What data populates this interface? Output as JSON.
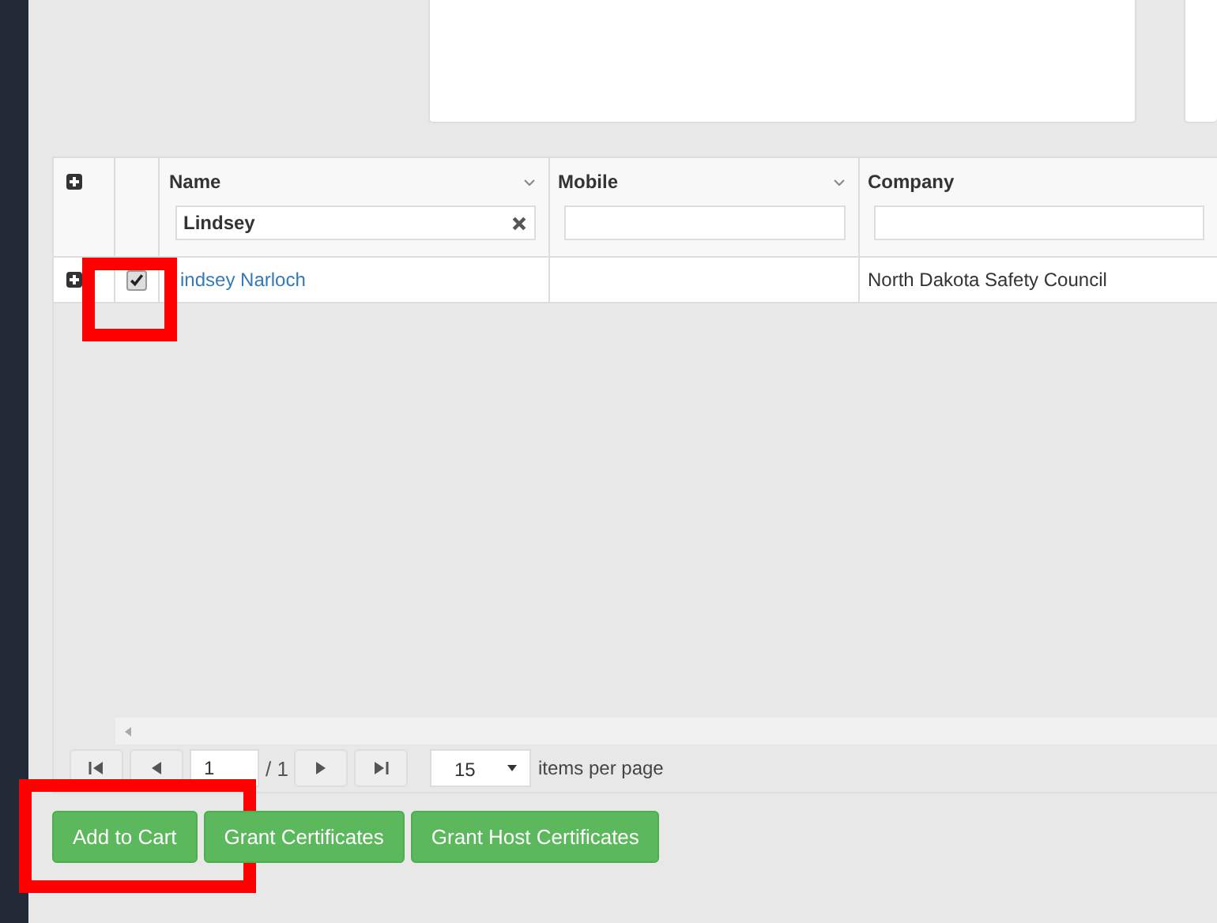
{
  "grid": {
    "columns": [
      {
        "title": "Name",
        "filter": "Lindsey",
        "menu": true
      },
      {
        "title": "Mobile",
        "menu": true
      },
      {
        "title": "Company",
        "menu": false
      }
    ],
    "rows": [
      {
        "selected": true,
        "name": "indsey Narloch",
        "company": "North Dakota Safety Council"
      }
    ]
  },
  "pager": {
    "page": "1",
    "total_label": "/ 1",
    "page_size": "15",
    "items_label": "items per page"
  },
  "buttons": [
    "Add to Cart",
    "Grant Certificates",
    "Grant Host Certificates"
  ]
}
